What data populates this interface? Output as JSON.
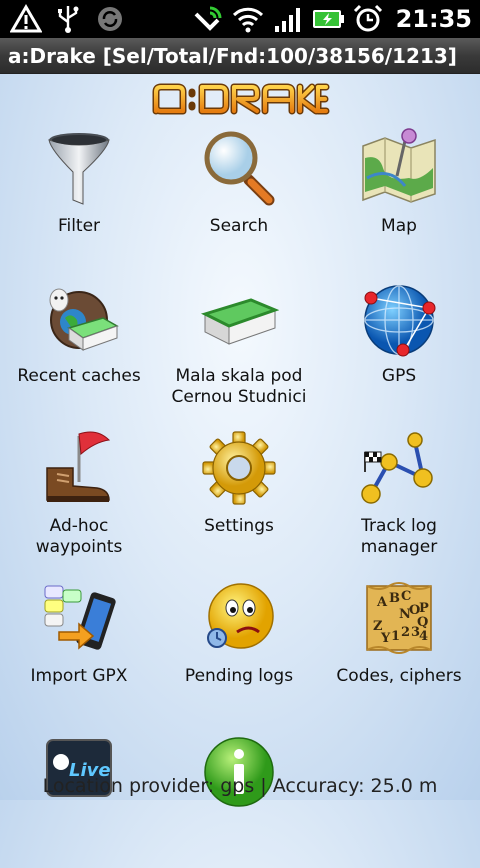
{
  "status_bar": {
    "time": "21:35",
    "icons_left": [
      "warning-icon",
      "usb-icon",
      "sync-icon"
    ],
    "icons_right": [
      "gps-phone-icon",
      "wifi-icon",
      "signal-icon",
      "battery-icon",
      "alarm-icon"
    ]
  },
  "title": "a:Drake [Sel/Total/Fnd:100/38156/1213]",
  "logo_text": "a:DRAKE",
  "menu": [
    {
      "label": "Filter",
      "icon": "funnel-icon"
    },
    {
      "label": "Search",
      "icon": "magnifier-icon"
    },
    {
      "label": "Map",
      "icon": "map-icon"
    },
    {
      "label": "Recent caches",
      "icon": "recent-caches-icon"
    },
    {
      "label": "Mala skala pod Cernou Studnici",
      "icon": "cache-box-icon"
    },
    {
      "label": "GPS",
      "icon": "globe-icon"
    },
    {
      "label": "Ad-hoc waypoints",
      "icon": "boot-flag-icon"
    },
    {
      "label": "Settings",
      "icon": "gear-icon"
    },
    {
      "label": "Track log manager",
      "icon": "track-log-icon"
    },
    {
      "label": "Import GPX",
      "icon": "import-phone-icon"
    },
    {
      "label": "Pending logs",
      "icon": "sad-smiley-icon"
    },
    {
      "label": "Codes, ciphers",
      "icon": "cipher-scroll-icon"
    },
    {
      "label": "Live",
      "icon": "live-icon"
    },
    {
      "label": "Info",
      "icon": "info-icon"
    }
  ],
  "footer": "Location provider: gps | Accuracy: 25.0 m",
  "colors": {
    "title_bar": "#3a3a3a",
    "logo": "#f29a1f",
    "background": "#dce9f7"
  }
}
